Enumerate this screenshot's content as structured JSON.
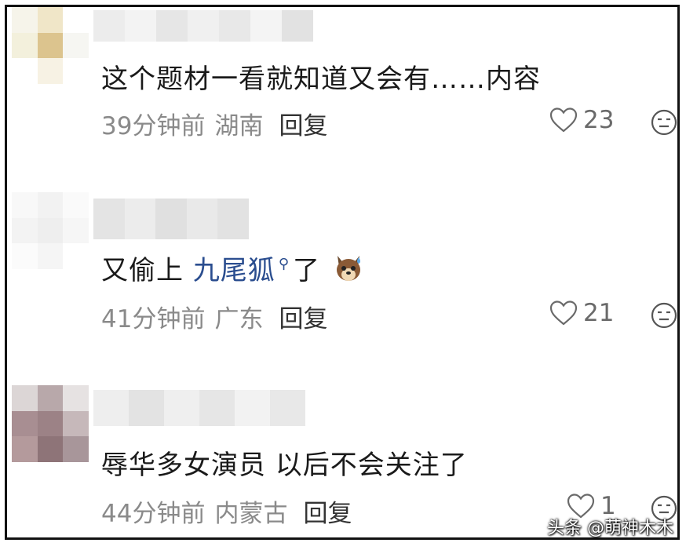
{
  "comments": [
    {
      "text": "这个题材一看就知道又会有……内容",
      "time": "39分钟前",
      "location": "湖南",
      "reply_label": "回复",
      "likes": "23"
    },
    {
      "text_prefix": "又偷上 ",
      "link_text": "九尾狐",
      "text_suffix": "了",
      "time": "41分钟前",
      "location": "广东",
      "reply_label": "回复",
      "likes": "21"
    },
    {
      "text": "辱华多女演员 以后不会关注了",
      "time": "44分钟前",
      "location": "内蒙古",
      "reply_label": "回复",
      "likes": "1"
    }
  ],
  "watermark": "头条 @萌神木木",
  "icons": {
    "like": "heart-outline-icon",
    "reaction": "neutral-face-icon",
    "search": "search-icon",
    "emoji": "dog-sweat-emoji"
  },
  "colors": {
    "link": "#2a4d8f",
    "meta": "#8a8a8a",
    "text": "#1a1a1a"
  }
}
